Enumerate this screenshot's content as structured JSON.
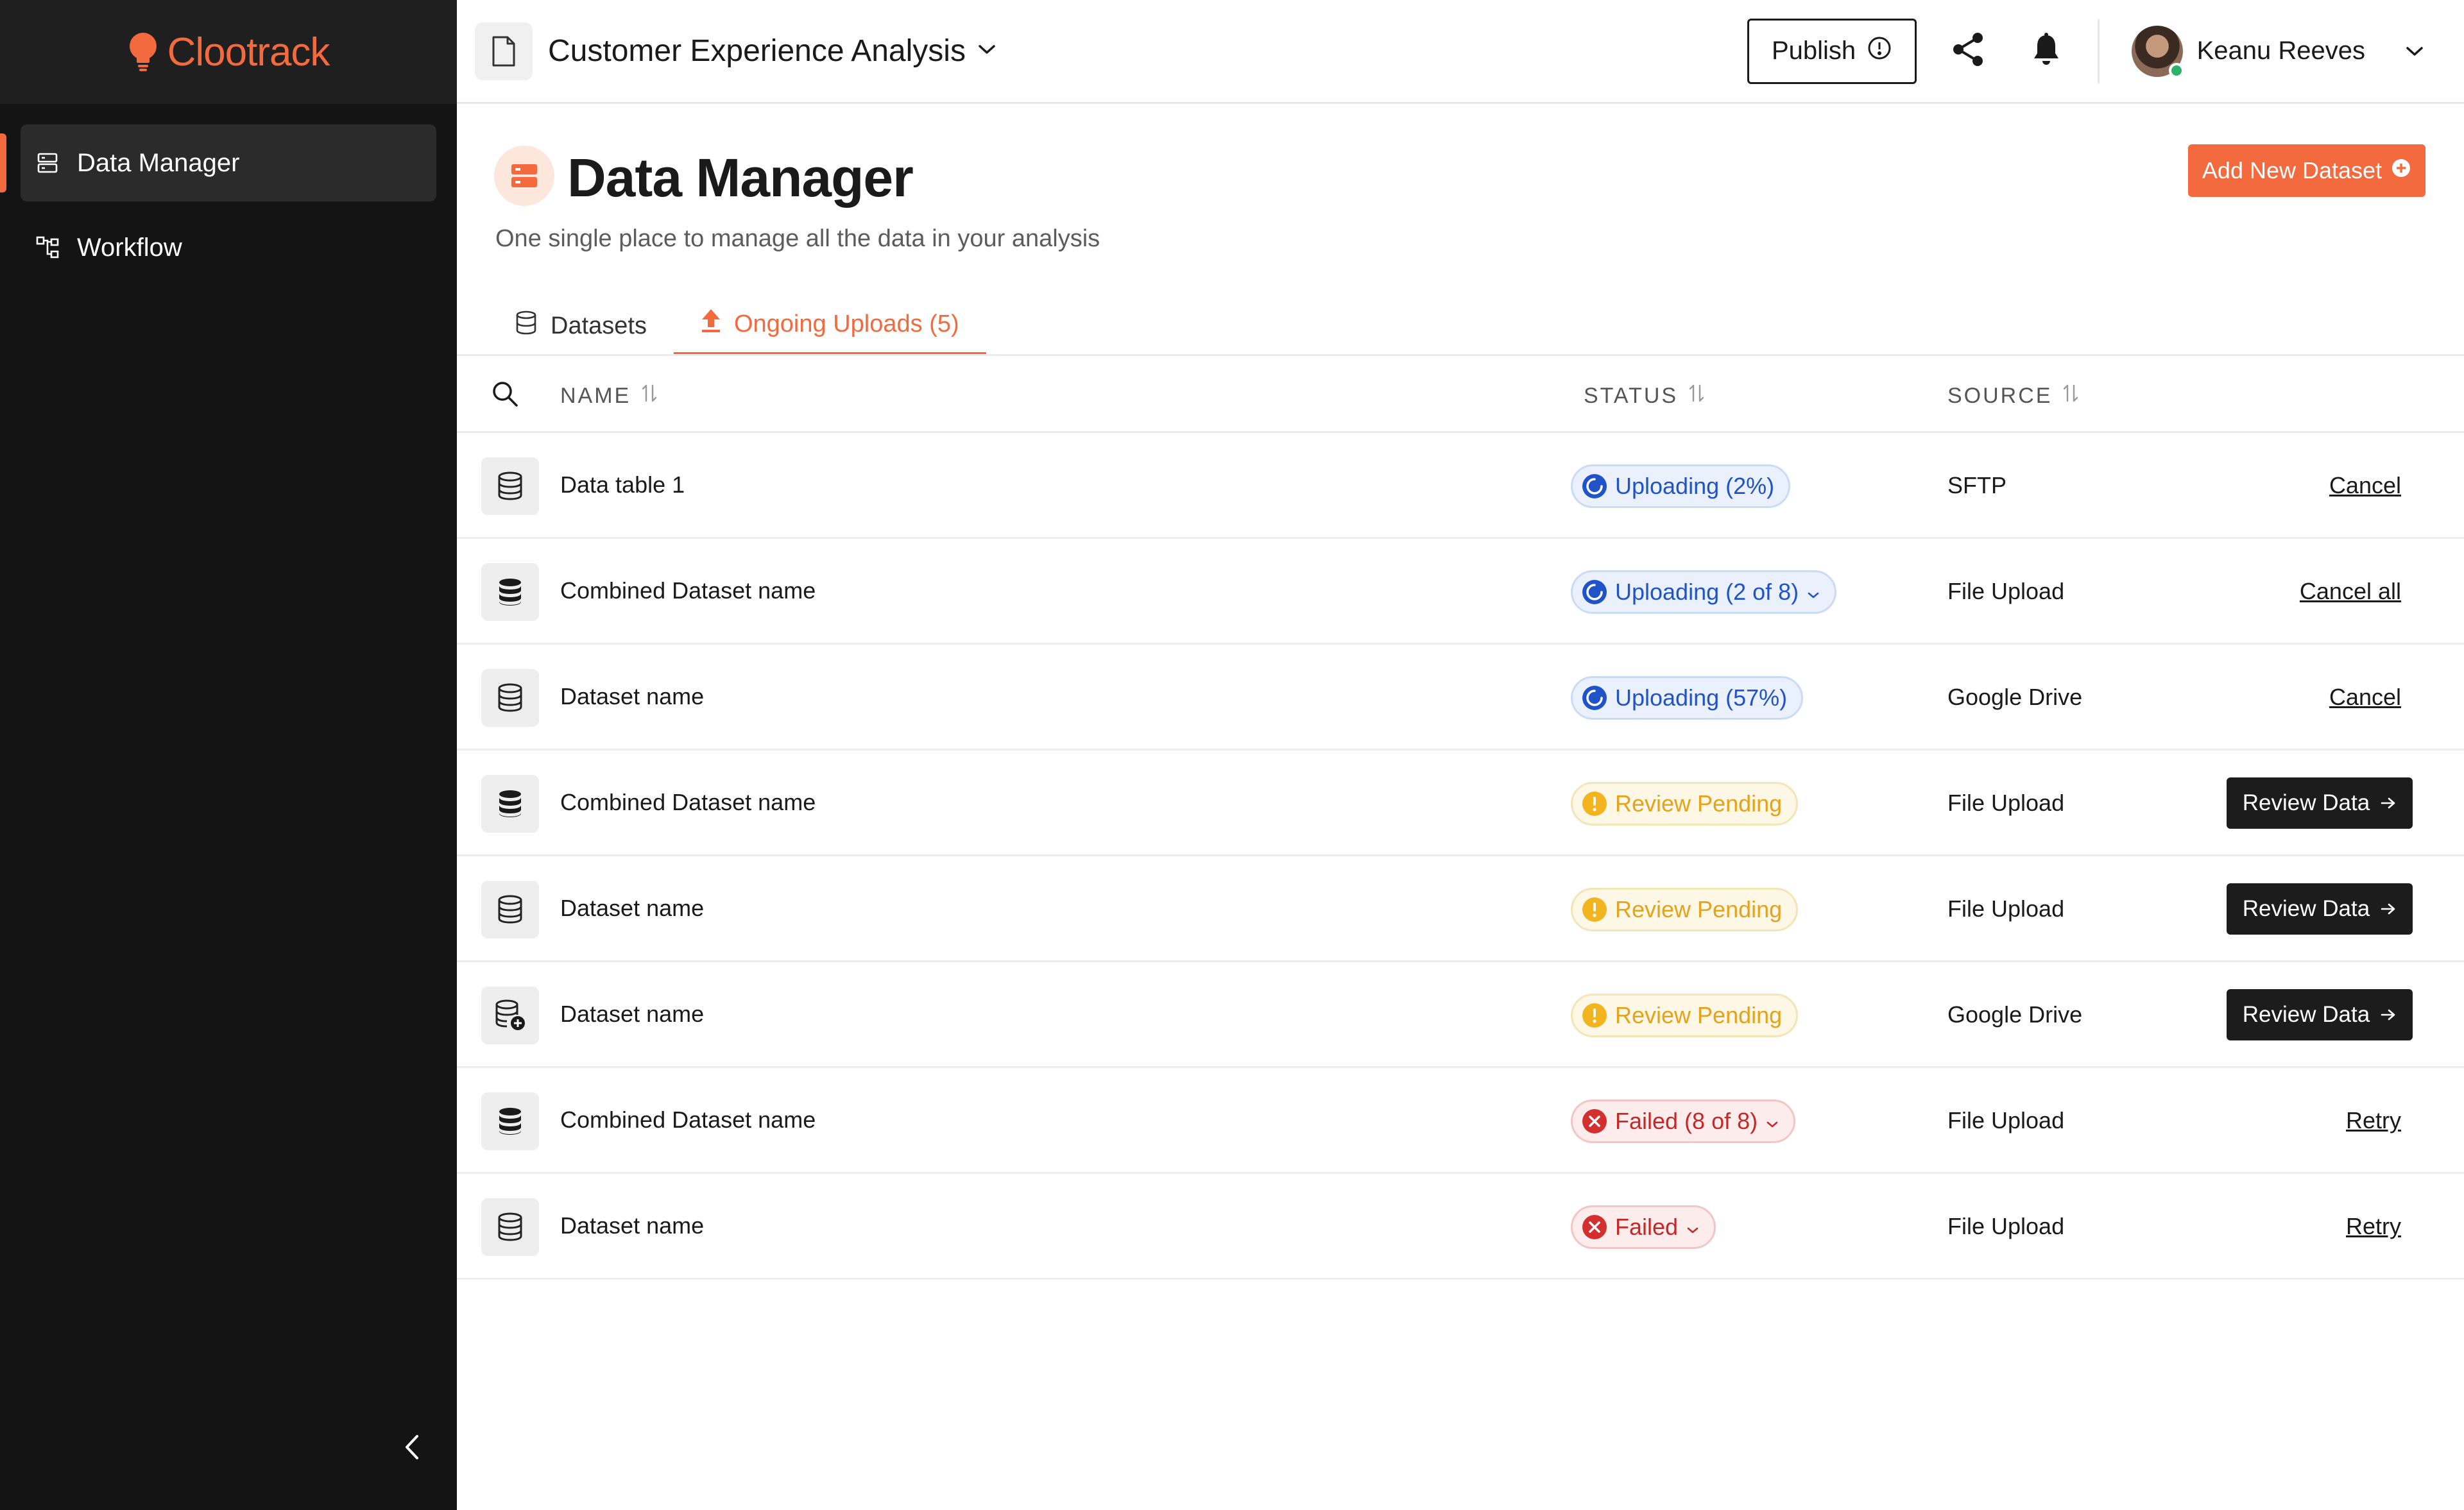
{
  "brand": {
    "name": "Clootrack",
    "accent": "#f26a3d"
  },
  "sidebar": {
    "items": [
      {
        "label": "Data Manager",
        "icon": "server-icon",
        "active": true
      },
      {
        "label": "Workflow",
        "icon": "workflow-icon",
        "active": false
      }
    ],
    "collapse_icon": "chevron-left-icon"
  },
  "topbar": {
    "project_title": "Customer Experience Analysis",
    "publish_label": "Publish",
    "user_name": "Keanu Reeves"
  },
  "page": {
    "title": "Data Manager",
    "subtitle": "One single place to manage all the data in your analysis",
    "add_button_label": "Add New Dataset",
    "tabs": [
      {
        "label": "Datasets",
        "active": false
      },
      {
        "label": "Ongoing Uploads (5)",
        "active": true
      }
    ]
  },
  "table": {
    "columns": {
      "name": "NAME",
      "status": "STATUS",
      "source": "SOURCE"
    },
    "rows": [
      {
        "icon": "database-outline-icon",
        "name": "Data table 1",
        "status": "Uploading (2%)",
        "status_type": "uploading",
        "status_dropdown": false,
        "source": "SFTP",
        "action": "Cancel",
        "action_type": "link"
      },
      {
        "icon": "database-filled-icon",
        "name": "Combined Dataset name",
        "status": "Uploading (2 of 8)",
        "status_type": "uploading",
        "status_dropdown": true,
        "source": "File Upload",
        "action": "Cancel all",
        "action_type": "link"
      },
      {
        "icon": "database-outline-icon",
        "name": "Dataset name",
        "status": "Uploading (57%)",
        "status_type": "uploading",
        "status_dropdown": false,
        "source": "Google Drive",
        "action": "Cancel",
        "action_type": "link"
      },
      {
        "icon": "database-filled-icon",
        "name": "Combined Dataset name",
        "status": "Review Pending",
        "status_type": "pending",
        "status_dropdown": false,
        "source": "File Upload",
        "action": "Review Data",
        "action_type": "button"
      },
      {
        "icon": "database-outline-icon",
        "name": "Dataset name",
        "status": "Review Pending",
        "status_type": "pending",
        "status_dropdown": false,
        "source": "File Upload",
        "action": "Review Data",
        "action_type": "button"
      },
      {
        "icon": "database-add-icon",
        "name": "Dataset name",
        "status": "Review Pending",
        "status_type": "pending",
        "status_dropdown": false,
        "source": "Google Drive",
        "action": "Review Data",
        "action_type": "button"
      },
      {
        "icon": "database-filled-icon",
        "name": "Combined Dataset name",
        "status": "Failed (8 of 8)",
        "status_type": "failed",
        "status_dropdown": true,
        "source": "File Upload",
        "action": "Retry",
        "action_type": "link"
      },
      {
        "icon": "database-outline-icon",
        "name": "Dataset name",
        "status": "Failed",
        "status_type": "failed",
        "status_dropdown": true,
        "source": "File Upload",
        "action": "Retry",
        "action_type": "link"
      }
    ]
  },
  "colors": {
    "uploading": "#1f53c7",
    "pending": "#e5a21b",
    "failed": "#c62828",
    "sidebar_bg": "#141414"
  }
}
